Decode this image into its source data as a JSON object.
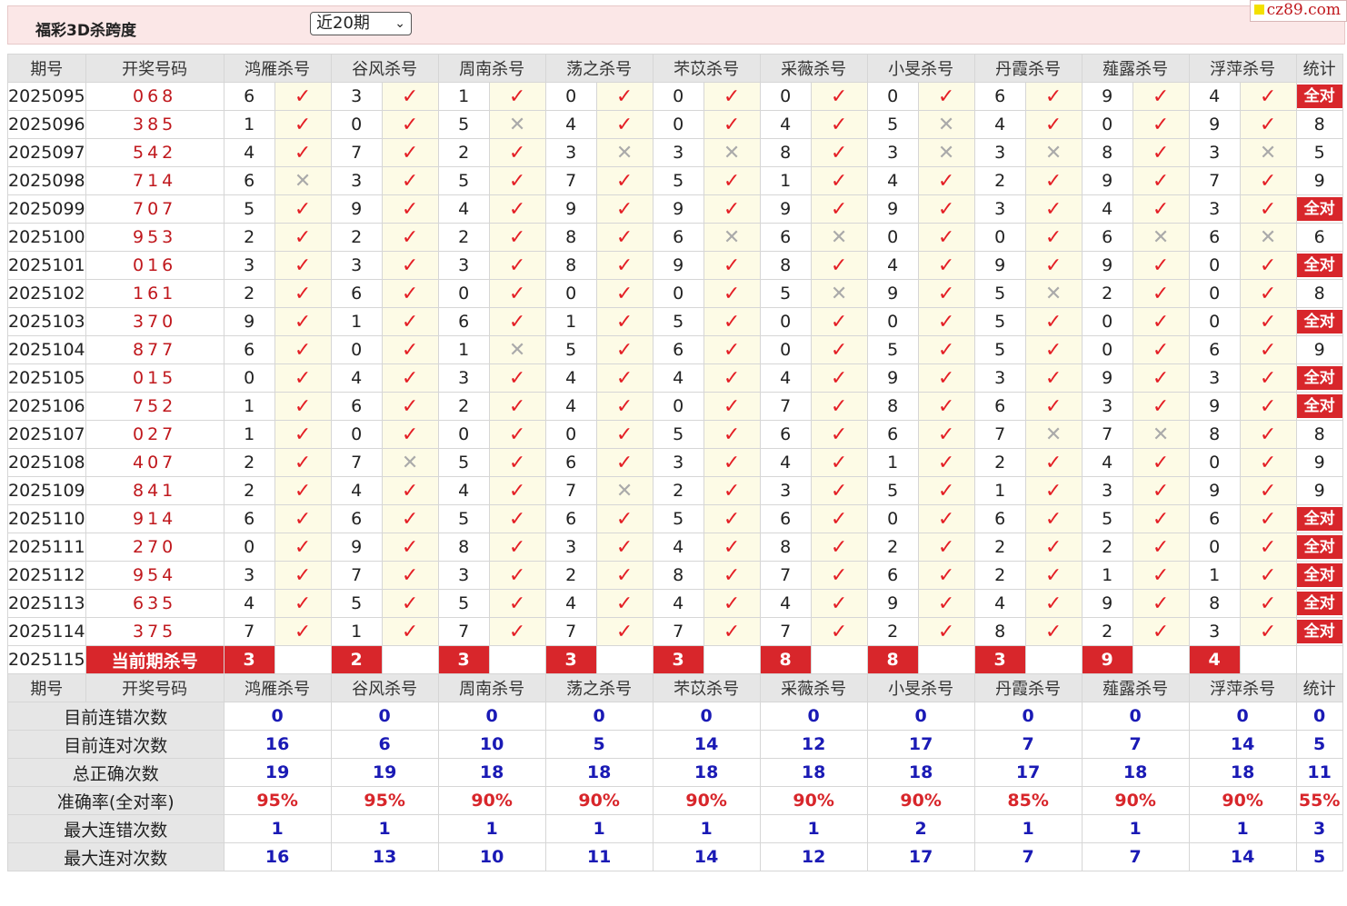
{
  "header": {
    "title": "福彩3D杀跨度",
    "period_select": "近20期",
    "site": "cz89.com"
  },
  "columns": {
    "issue": "期号",
    "draw": "开奖号码",
    "experts": [
      "鸿雁杀号",
      "谷风杀号",
      "周南杀号",
      "荡之杀号",
      "芣苡杀号",
      "采薇杀号",
      "小旻杀号",
      "丹霞杀号",
      "薤露杀号",
      "浮萍杀号"
    ],
    "stat": "统计"
  },
  "icons": {
    "tick": "check-icon",
    "cross": "cross-icon"
  },
  "all_correct_label": "全对",
  "rows": [
    {
      "issue": "2025095",
      "draw": "068",
      "picks": [
        [
          6,
          1
        ],
        [
          3,
          1
        ],
        [
          1,
          1
        ],
        [
          0,
          1
        ],
        [
          0,
          1
        ],
        [
          0,
          1
        ],
        [
          0,
          1
        ],
        [
          6,
          1
        ],
        [
          9,
          1
        ],
        [
          4,
          1
        ]
      ],
      "stat": "全对"
    },
    {
      "issue": "2025096",
      "draw": "385",
      "picks": [
        [
          1,
          1
        ],
        [
          0,
          1
        ],
        [
          5,
          0
        ],
        [
          4,
          1
        ],
        [
          0,
          1
        ],
        [
          4,
          1
        ],
        [
          5,
          0
        ],
        [
          4,
          1
        ],
        [
          0,
          1
        ],
        [
          9,
          1
        ]
      ],
      "stat": "8"
    },
    {
      "issue": "2025097",
      "draw": "542",
      "picks": [
        [
          4,
          1
        ],
        [
          7,
          1
        ],
        [
          2,
          1
        ],
        [
          3,
          0
        ],
        [
          3,
          0
        ],
        [
          8,
          1
        ],
        [
          3,
          0
        ],
        [
          3,
          0
        ],
        [
          8,
          1
        ],
        [
          3,
          0
        ]
      ],
      "stat": "5"
    },
    {
      "issue": "2025098",
      "draw": "714",
      "picks": [
        [
          6,
          0
        ],
        [
          3,
          1
        ],
        [
          5,
          1
        ],
        [
          7,
          1
        ],
        [
          5,
          1
        ],
        [
          1,
          1
        ],
        [
          4,
          1
        ],
        [
          2,
          1
        ],
        [
          9,
          1
        ],
        [
          7,
          1
        ]
      ],
      "stat": "9"
    },
    {
      "issue": "2025099",
      "draw": "707",
      "picks": [
        [
          5,
          1
        ],
        [
          9,
          1
        ],
        [
          4,
          1
        ],
        [
          9,
          1
        ],
        [
          9,
          1
        ],
        [
          9,
          1
        ],
        [
          9,
          1
        ],
        [
          3,
          1
        ],
        [
          4,
          1
        ],
        [
          3,
          1
        ]
      ],
      "stat": "全对"
    },
    {
      "issue": "2025100",
      "draw": "953",
      "picks": [
        [
          2,
          1
        ],
        [
          2,
          1
        ],
        [
          2,
          1
        ],
        [
          8,
          1
        ],
        [
          6,
          0
        ],
        [
          6,
          0
        ],
        [
          0,
          1
        ],
        [
          0,
          1
        ],
        [
          6,
          0
        ],
        [
          6,
          0
        ]
      ],
      "stat": "6"
    },
    {
      "issue": "2025101",
      "draw": "016",
      "picks": [
        [
          3,
          1
        ],
        [
          3,
          1
        ],
        [
          3,
          1
        ],
        [
          8,
          1
        ],
        [
          9,
          1
        ],
        [
          8,
          1
        ],
        [
          4,
          1
        ],
        [
          9,
          1
        ],
        [
          9,
          1
        ],
        [
          0,
          1
        ]
      ],
      "stat": "全对"
    },
    {
      "issue": "2025102",
      "draw": "161",
      "picks": [
        [
          2,
          1
        ],
        [
          6,
          1
        ],
        [
          0,
          1
        ],
        [
          0,
          1
        ],
        [
          0,
          1
        ],
        [
          5,
          0
        ],
        [
          9,
          1
        ],
        [
          5,
          0
        ],
        [
          2,
          1
        ],
        [
          0,
          1
        ]
      ],
      "stat": "8"
    },
    {
      "issue": "2025103",
      "draw": "370",
      "picks": [
        [
          9,
          1
        ],
        [
          1,
          1
        ],
        [
          6,
          1
        ],
        [
          1,
          1
        ],
        [
          5,
          1
        ],
        [
          0,
          1
        ],
        [
          0,
          1
        ],
        [
          5,
          1
        ],
        [
          0,
          1
        ],
        [
          0,
          1
        ]
      ],
      "stat": "全对"
    },
    {
      "issue": "2025104",
      "draw": "877",
      "picks": [
        [
          6,
          1
        ],
        [
          0,
          1
        ],
        [
          1,
          0
        ],
        [
          5,
          1
        ],
        [
          6,
          1
        ],
        [
          0,
          1
        ],
        [
          5,
          1
        ],
        [
          5,
          1
        ],
        [
          0,
          1
        ],
        [
          6,
          1
        ]
      ],
      "stat": "9"
    },
    {
      "issue": "2025105",
      "draw": "015",
      "picks": [
        [
          0,
          1
        ],
        [
          4,
          1
        ],
        [
          3,
          1
        ],
        [
          4,
          1
        ],
        [
          4,
          1
        ],
        [
          4,
          1
        ],
        [
          9,
          1
        ],
        [
          3,
          1
        ],
        [
          9,
          1
        ],
        [
          3,
          1
        ]
      ],
      "stat": "全对"
    },
    {
      "issue": "2025106",
      "draw": "752",
      "picks": [
        [
          1,
          1
        ],
        [
          6,
          1
        ],
        [
          2,
          1
        ],
        [
          4,
          1
        ],
        [
          0,
          1
        ],
        [
          7,
          1
        ],
        [
          8,
          1
        ],
        [
          6,
          1
        ],
        [
          3,
          1
        ],
        [
          9,
          1
        ]
      ],
      "stat": "全对"
    },
    {
      "issue": "2025107",
      "draw": "027",
      "picks": [
        [
          1,
          1
        ],
        [
          0,
          1
        ],
        [
          0,
          1
        ],
        [
          0,
          1
        ],
        [
          5,
          1
        ],
        [
          6,
          1
        ],
        [
          6,
          1
        ],
        [
          7,
          0
        ],
        [
          7,
          0
        ],
        [
          8,
          1
        ]
      ],
      "stat": "8"
    },
    {
      "issue": "2025108",
      "draw": "407",
      "picks": [
        [
          2,
          1
        ],
        [
          7,
          0
        ],
        [
          5,
          1
        ],
        [
          6,
          1
        ],
        [
          3,
          1
        ],
        [
          4,
          1
        ],
        [
          1,
          1
        ],
        [
          2,
          1
        ],
        [
          4,
          1
        ],
        [
          0,
          1
        ]
      ],
      "stat": "9"
    },
    {
      "issue": "2025109",
      "draw": "841",
      "picks": [
        [
          2,
          1
        ],
        [
          4,
          1
        ],
        [
          4,
          1
        ],
        [
          7,
          0
        ],
        [
          2,
          1
        ],
        [
          3,
          1
        ],
        [
          5,
          1
        ],
        [
          1,
          1
        ],
        [
          3,
          1
        ],
        [
          9,
          1
        ]
      ],
      "stat": "9"
    },
    {
      "issue": "2025110",
      "draw": "914",
      "picks": [
        [
          6,
          1
        ],
        [
          6,
          1
        ],
        [
          5,
          1
        ],
        [
          6,
          1
        ],
        [
          5,
          1
        ],
        [
          6,
          1
        ],
        [
          0,
          1
        ],
        [
          6,
          1
        ],
        [
          5,
          1
        ],
        [
          6,
          1
        ]
      ],
      "stat": "全对"
    },
    {
      "issue": "2025111",
      "draw": "270",
      "picks": [
        [
          0,
          1
        ],
        [
          9,
          1
        ],
        [
          8,
          1
        ],
        [
          3,
          1
        ],
        [
          4,
          1
        ],
        [
          8,
          1
        ],
        [
          2,
          1
        ],
        [
          2,
          1
        ],
        [
          2,
          1
        ],
        [
          0,
          1
        ]
      ],
      "stat": "全对"
    },
    {
      "issue": "2025112",
      "draw": "954",
      "picks": [
        [
          3,
          1
        ],
        [
          7,
          1
        ],
        [
          3,
          1
        ],
        [
          2,
          1
        ],
        [
          8,
          1
        ],
        [
          7,
          1
        ],
        [
          6,
          1
        ],
        [
          2,
          1
        ],
        [
          1,
          1
        ],
        [
          1,
          1
        ]
      ],
      "stat": "全对"
    },
    {
      "issue": "2025113",
      "draw": "635",
      "picks": [
        [
          4,
          1
        ],
        [
          5,
          1
        ],
        [
          5,
          1
        ],
        [
          4,
          1
        ],
        [
          4,
          1
        ],
        [
          4,
          1
        ],
        [
          9,
          1
        ],
        [
          4,
          1
        ],
        [
          9,
          1
        ],
        [
          8,
          1
        ]
      ],
      "stat": "全对"
    },
    {
      "issue": "2025114",
      "draw": "375",
      "picks": [
        [
          7,
          1
        ],
        [
          1,
          1
        ],
        [
          7,
          1
        ],
        [
          7,
          1
        ],
        [
          7,
          1
        ],
        [
          7,
          1
        ],
        [
          2,
          1
        ],
        [
          8,
          1
        ],
        [
          2,
          1
        ],
        [
          3,
          1
        ]
      ],
      "stat": "全对"
    }
  ],
  "current": {
    "issue": "2025115",
    "label": "当前期杀号",
    "picks": [
      3,
      2,
      3,
      3,
      3,
      8,
      8,
      3,
      9,
      4
    ]
  },
  "summary": [
    {
      "label": "目前连错次数",
      "values": [
        "0",
        "0",
        "0",
        "0",
        "0",
        "0",
        "0",
        "0",
        "0",
        "0"
      ],
      "stat": "0"
    },
    {
      "label": "目前连对次数",
      "values": [
        "16",
        "6",
        "10",
        "5",
        "14",
        "12",
        "17",
        "7",
        "7",
        "14"
      ],
      "stat": "5"
    },
    {
      "label": "总正确次数",
      "values": [
        "19",
        "19",
        "18",
        "18",
        "18",
        "18",
        "18",
        "17",
        "18",
        "18"
      ],
      "stat": "11"
    },
    {
      "label": "准确率(全对率)",
      "values": [
        "95%",
        "95%",
        "90%",
        "90%",
        "90%",
        "90%",
        "90%",
        "85%",
        "90%",
        "90%"
      ],
      "stat": "55%",
      "red": true
    },
    {
      "label": "最大连错次数",
      "values": [
        "1",
        "1",
        "1",
        "1",
        "1",
        "1",
        "2",
        "1",
        "1",
        "1"
      ],
      "stat": "3"
    },
    {
      "label": "最大连对次数",
      "values": [
        "16",
        "13",
        "10",
        "11",
        "14",
        "12",
        "17",
        "7",
        "7",
        "14"
      ],
      "stat": "5"
    }
  ]
}
